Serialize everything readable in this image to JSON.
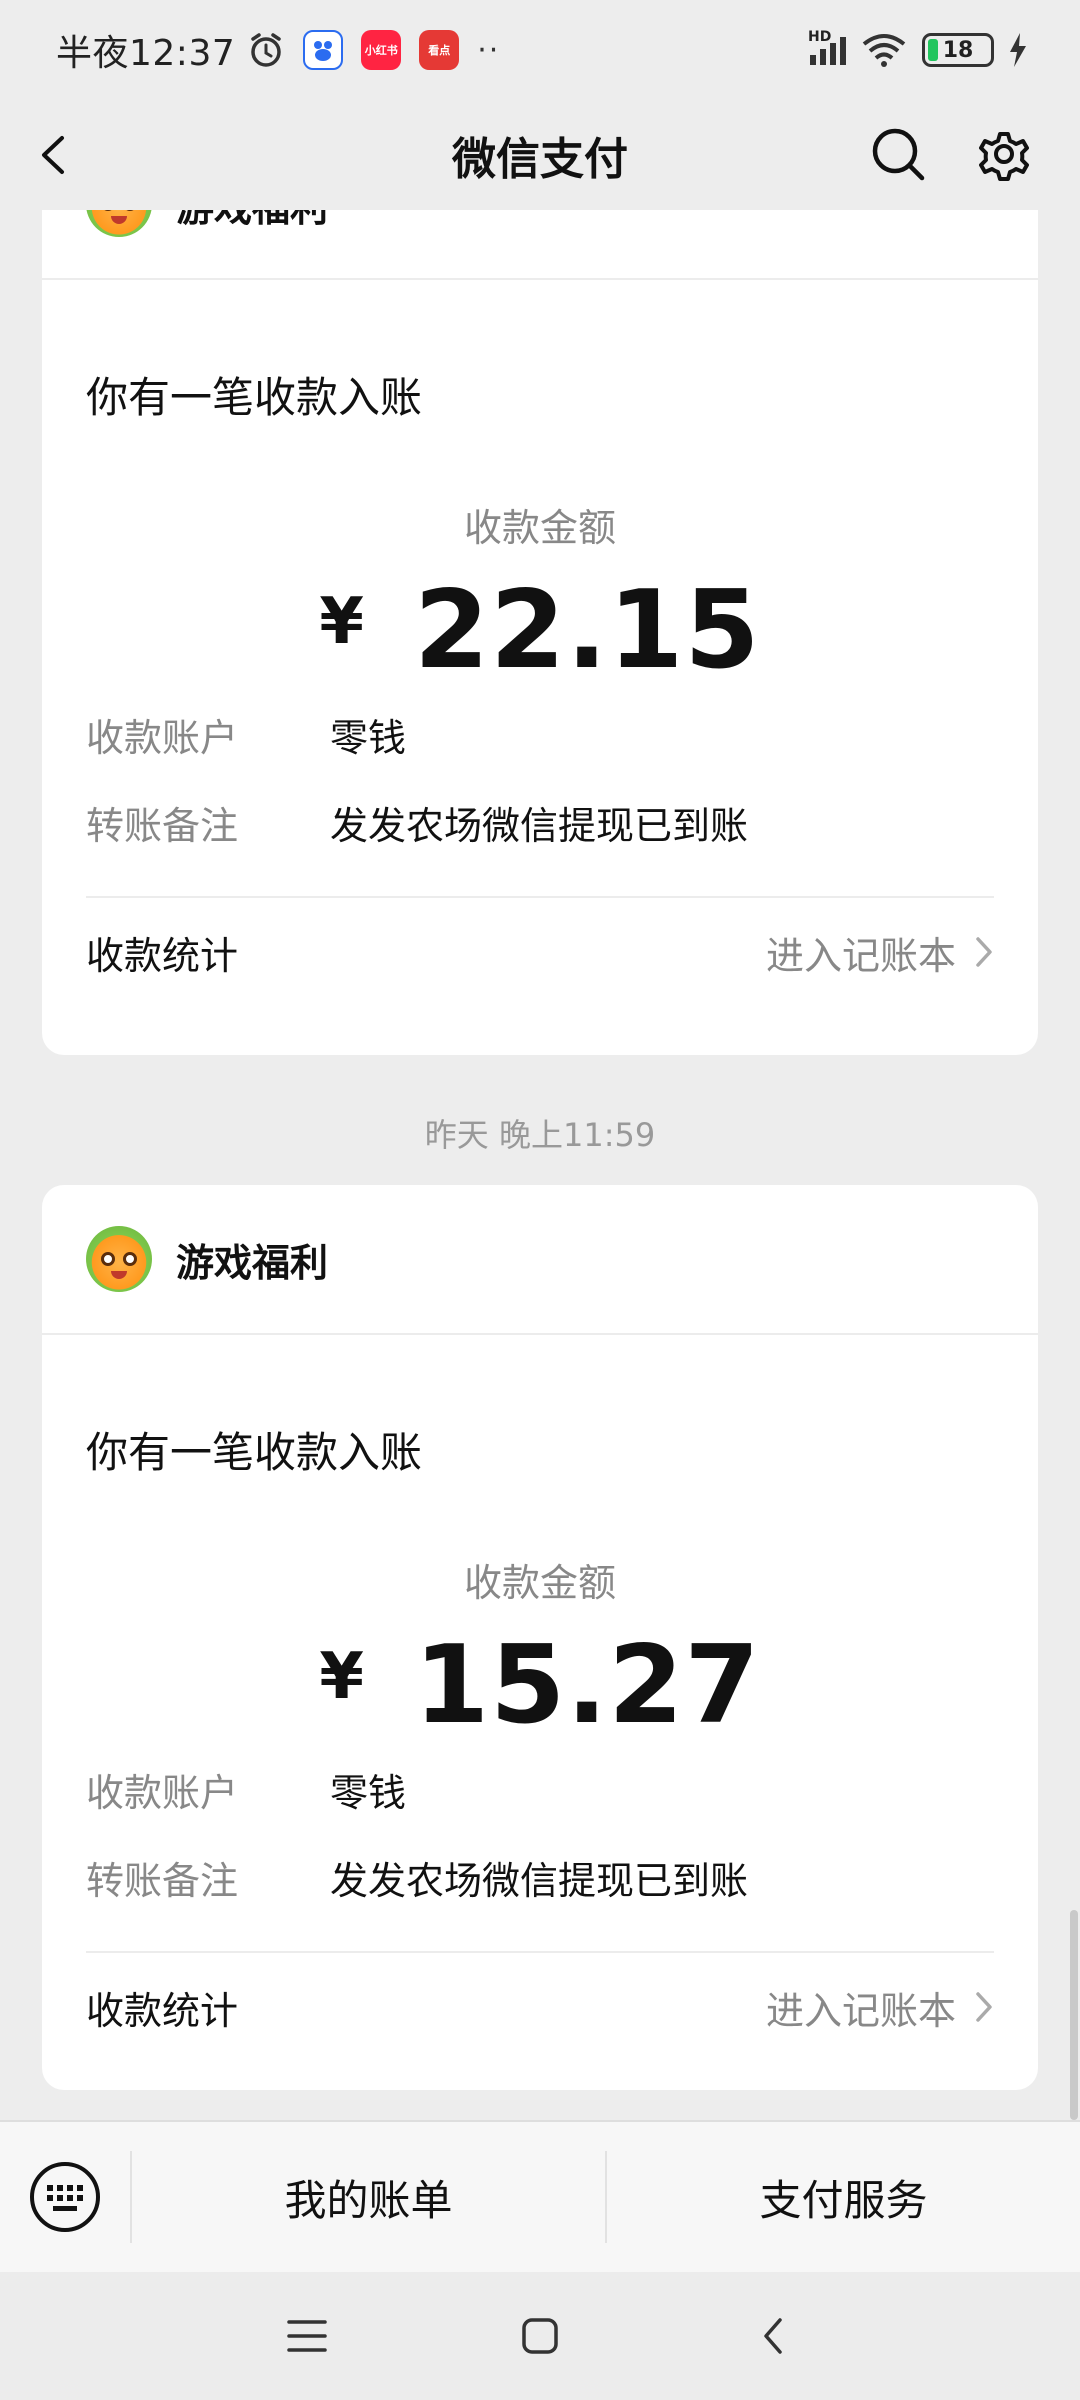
{
  "status_bar": {
    "time": "半夜12:37",
    "battery": "18",
    "network_badge": "HD",
    "app_badges": [
      "小红书",
      "看点"
    ],
    "more_dots": "··"
  },
  "nav": {
    "title": "微信支付",
    "back_icon": "back-chevron-icon",
    "search_icon": "search-icon",
    "settings_icon": "gear-icon"
  },
  "messages": [
    {
      "sender": "游戏福利",
      "headline": "你有一笔收款入账",
      "amount_label": "收款金额",
      "currency": "¥",
      "amount": "22.15",
      "rows": [
        {
          "key": "收款账户",
          "value": "零钱"
        },
        {
          "key": "转账备注",
          "value": "发发农场微信提现已到账"
        }
      ],
      "stats_label": "收款统计",
      "stats_link": "进入记账本"
    },
    {
      "timestamp": "昨天 晚上11:59",
      "sender": "游戏福利",
      "headline": "你有一笔收款入账",
      "amount_label": "收款金额",
      "currency": "¥",
      "amount": "15.27",
      "rows": [
        {
          "key": "收款账户",
          "value": "零钱"
        },
        {
          "key": "转账备注",
          "value": "发发农场微信提现已到账"
        }
      ],
      "stats_label": "收款统计",
      "stats_link": "进入记账本"
    }
  ],
  "bottom_bar": {
    "keyboard_icon": "keyboard-icon",
    "items": [
      "我的账单",
      "支付服务"
    ]
  },
  "system_nav": [
    "menu-icon",
    "home-icon",
    "back-icon"
  ],
  "colors": {
    "background": "#ededed",
    "card": "#ffffff",
    "muted_text": "#888888",
    "battery_green": "#22c55e"
  }
}
